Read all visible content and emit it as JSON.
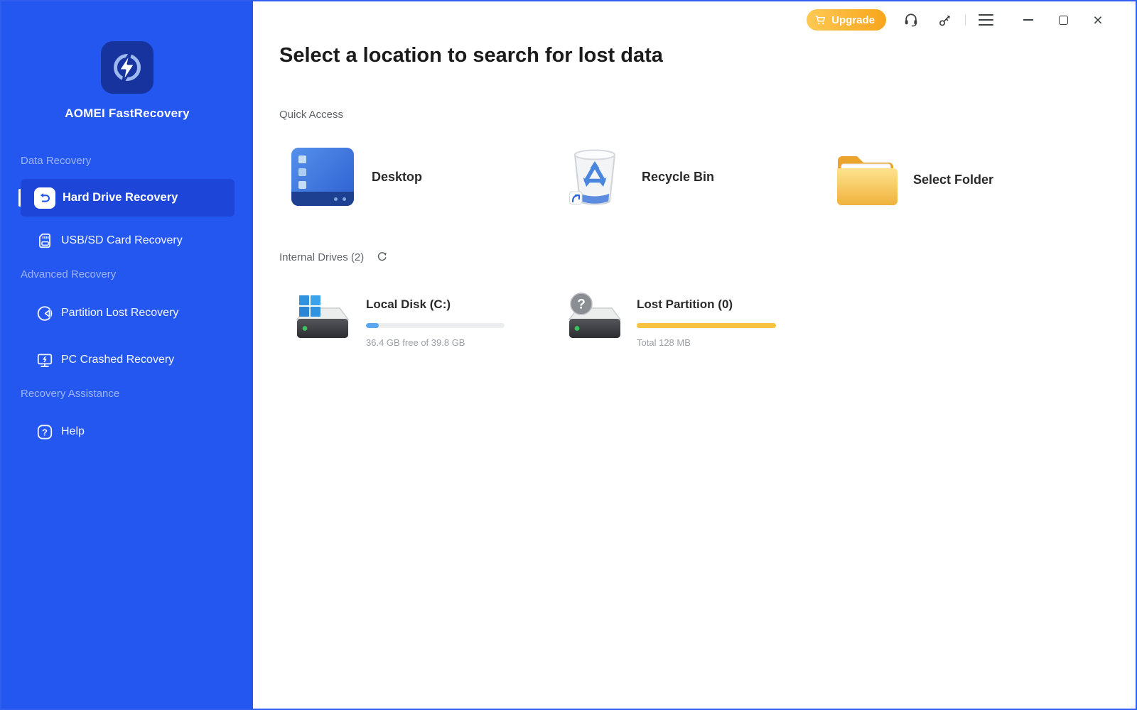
{
  "titlebar": {
    "upgrade_label": "Upgrade",
    "icons": [
      "cart-icon",
      "headset-icon",
      "key-icon",
      "menu-icon",
      "minimize-icon",
      "maximize-icon",
      "close-icon"
    ]
  },
  "sidebar": {
    "app_name": "AOMEI FastRecovery",
    "logo_icon": "lightning-bolt-icon",
    "sections": [
      {
        "label": "Data Recovery",
        "items": [
          {
            "label": "Hard Drive Recovery",
            "icon": "undo-arrow-icon",
            "active": true
          },
          {
            "label": "USB/SD Card Recovery",
            "icon": "sd-card-icon",
            "active": false
          }
        ]
      },
      {
        "label": "Advanced Recovery",
        "items": [
          {
            "label": "Partition Lost Recovery",
            "icon": "partition-icon",
            "active": false
          },
          {
            "label": "PC Crashed Recovery",
            "icon": "crashed-pc-icon",
            "active": false
          }
        ]
      },
      {
        "label": "Recovery Assistance",
        "items": [
          {
            "label": "Help",
            "icon": "question-icon",
            "active": false
          }
        ]
      }
    ]
  },
  "main": {
    "title": "Select a location to search for lost data",
    "quick_access": {
      "label": "Quick Access",
      "items": [
        {
          "label": "Desktop",
          "icon": "desktop-icon"
        },
        {
          "label": "Recycle Bin",
          "icon": "recycle-bin-icon"
        },
        {
          "label": "Select Folder",
          "icon": "folder-icon"
        }
      ]
    },
    "internal_drives": {
      "label": "Internal Drives (2)",
      "refresh_icon": "refresh-icon",
      "drives": [
        {
          "name": "Local Disk (C:)",
          "detail": "36.4 GB free of 39.8 GB",
          "icon": "hard-drive-windows-icon",
          "bar_percent": 9,
          "bar_color": "#58A7F0",
          "track_color": "#ECEDEF"
        },
        {
          "name": "Lost Partition (0)",
          "detail": "Total 128 MB",
          "icon": "hard-drive-unknown-icon",
          "bar_percent": 100,
          "bar_color": "#F6C343",
          "track_color": "#F6C343"
        }
      ]
    }
  },
  "colors": {
    "sidebar": "#2457EF",
    "sidebar_active_item": "#1D45D8",
    "window_border": "#2E5FF0",
    "upgrade_gradient_start": "#FFC954",
    "upgrade_gradient_end": "#F7A51B",
    "used_space_bar": "#58A7F0",
    "lost_partition_bar": "#F6C343"
  }
}
